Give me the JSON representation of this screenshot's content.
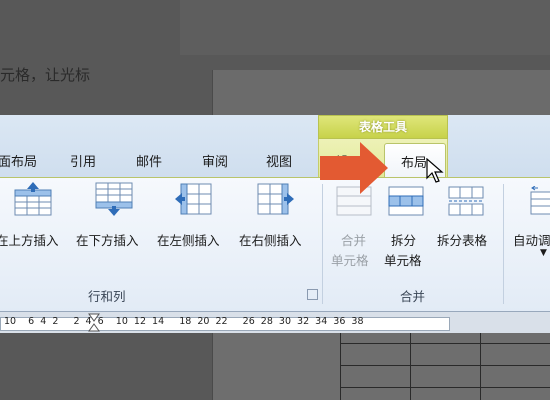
{
  "document": {
    "visible_text": "元格，让光标"
  },
  "ribbon": {
    "context_group_title": "表格工具",
    "tabs": [
      {
        "label": "面布局"
      },
      {
        "label": "引用"
      },
      {
        "label": "邮件"
      },
      {
        "label": "审阅"
      },
      {
        "label": "视图"
      },
      {
        "label": "设"
      },
      {
        "label": "布局",
        "active": true
      }
    ],
    "groups": {
      "rows_cols": {
        "label": "行和列",
        "commands": [
          "在上方插入",
          "在下方插入",
          "在左侧插入",
          "在右侧插入"
        ]
      },
      "merge": {
        "label": "合并",
        "merge_cells": [
          "合并",
          "单元格"
        ],
        "split_cells": [
          "拆分",
          "单元格"
        ],
        "split_table": "拆分表格"
      },
      "cellsize": {
        "autofit": "自动调"
      }
    }
  },
  "ruler": {
    "ticks": "10    6  4  2     2  4  6    10  12  14     18  20  22     26  28  30  32  34  36  38"
  },
  "colors": {
    "accent_arrow": "#e35a32",
    "context_yellow": "#d7df62",
    "ribbon_blue": "#dbe7f4"
  }
}
